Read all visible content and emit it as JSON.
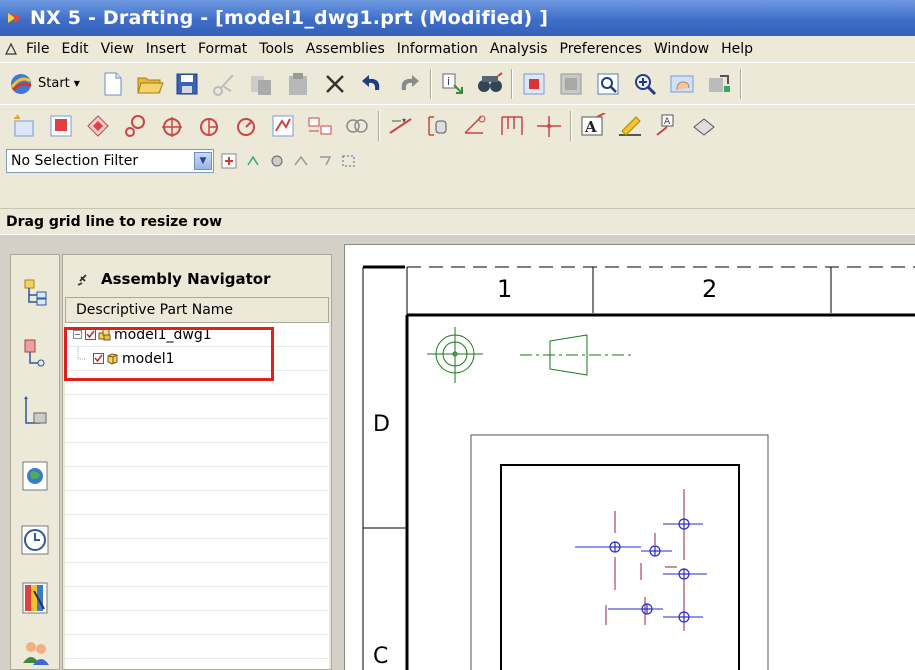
{
  "window": {
    "title": "NX 5 - Drafting - [model1_dwg1.prt (Modified) ]"
  },
  "menu": [
    {
      "label": "File"
    },
    {
      "label": "Edit"
    },
    {
      "label": "View"
    },
    {
      "label": "Insert"
    },
    {
      "label": "Format"
    },
    {
      "label": "Tools"
    },
    {
      "label": "Assemblies"
    },
    {
      "label": "Information"
    },
    {
      "label": "Analysis"
    },
    {
      "label": "Preferences"
    },
    {
      "label": "Window"
    },
    {
      "label": "Help"
    }
  ],
  "toolbar": {
    "start_label": "Start",
    "row1_icons": [
      "new-icon",
      "open-icon",
      "save-icon",
      "cut-icon",
      "copy-icon",
      "paste-icon",
      "delete-icon",
      "undo-icon",
      "redo-icon",
      "information-icon",
      "binoculars-icon",
      "fit-icon",
      "zoom-icon",
      "zoom-in-icon",
      "pan-icon",
      "layer-icon"
    ],
    "row2_icons": [
      "new-sheet-icon",
      "base-view-icon",
      "projected-view-icon",
      "detail-view-icon",
      "section-view-icon",
      "half-section-icon",
      "revolved-section-icon",
      "break-view-icon",
      "view-alignment-icon",
      "display-sheet-icon",
      "dimension-icon",
      "feature-control-icon",
      "datum-icon",
      "centerline-icon",
      "crosshair-icon",
      "note-icon",
      "edit-text-icon",
      "label-icon",
      "symbol-icon"
    ]
  },
  "filter": {
    "value": "No Selection Filter"
  },
  "status": {
    "text": "Drag grid line to resize row"
  },
  "navigator": {
    "title": "Assembly Navigator",
    "column_header": "Descriptive Part Name",
    "items": [
      {
        "label": "model1_dwg1",
        "level": 0
      },
      {
        "label": "model1",
        "level": 1
      }
    ],
    "empty_rows": 12
  },
  "drawing": {
    "columns": [
      "1",
      "2"
    ],
    "rows": [
      "D",
      "C"
    ],
    "colors": {
      "border": "#000000",
      "view_lines": "#1a7a1a",
      "features": "#2a2ad0",
      "centerlines": "#9a2040"
    }
  },
  "colors": {
    "title_bar": "#3f6ec9",
    "highlight": "#e0201a",
    "panel": "#ece9d8"
  }
}
